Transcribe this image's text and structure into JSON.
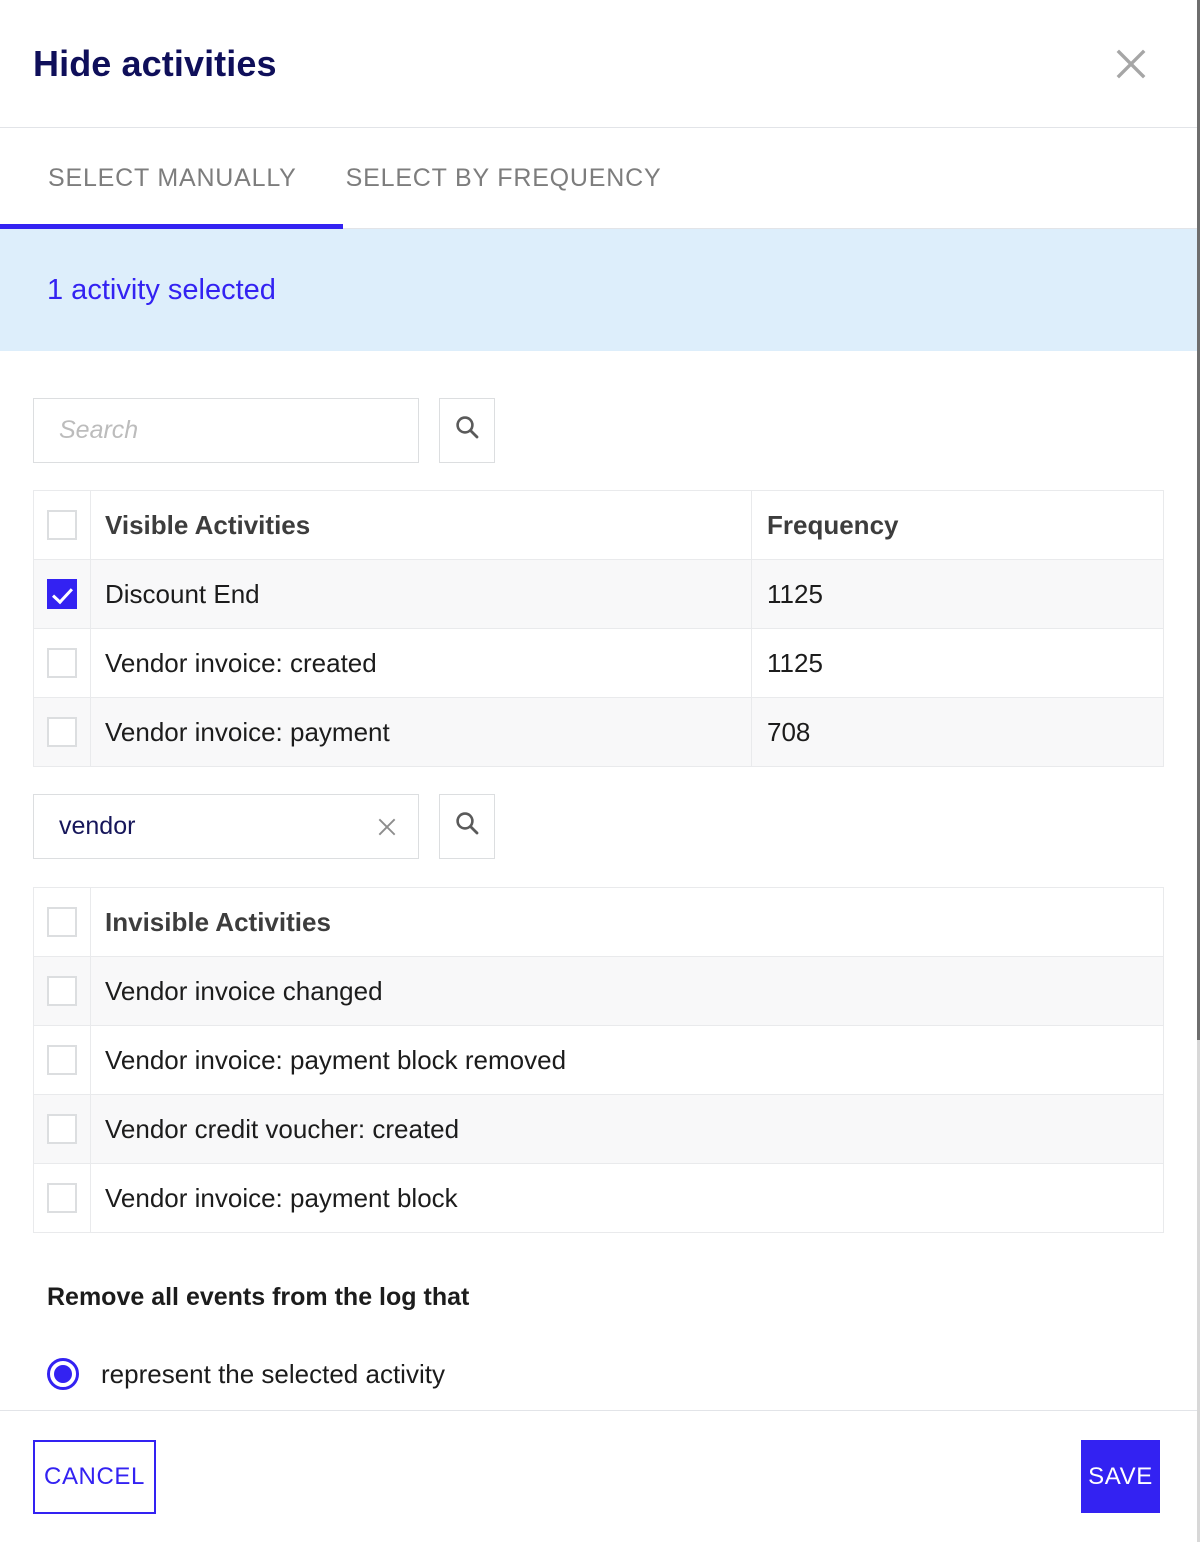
{
  "dialog": {
    "title": "Hide activities",
    "close_icon": "close-icon"
  },
  "tabs": [
    {
      "label": "SELECT MANUALLY",
      "active": true
    },
    {
      "label": "SELECT BY FREQUENCY",
      "active": false
    }
  ],
  "banner": {
    "text": "1 activity selected"
  },
  "visible_search": {
    "value": "",
    "placeholder": "Search",
    "search_icon": "search-icon"
  },
  "visible_table": {
    "columns": [
      "Visible Activities",
      "Frequency"
    ],
    "rows": [
      {
        "name": "Discount End",
        "frequency": "1125",
        "checked": true
      },
      {
        "name": "Vendor invoice: created",
        "frequency": "1125",
        "checked": false
      },
      {
        "name": "Vendor invoice: payment",
        "frequency": "708",
        "checked": false
      }
    ]
  },
  "invisible_search": {
    "value": "vendor",
    "placeholder": "Search",
    "clear_icon": "clear-icon",
    "search_icon": "search-icon"
  },
  "invisible_table": {
    "columns": [
      "Invisible Activities"
    ],
    "rows": [
      {
        "name": "Vendor invoice changed",
        "checked": false
      },
      {
        "name": "Vendor invoice: payment block removed",
        "checked": false
      },
      {
        "name": "Vendor credit voucher: created",
        "checked": false
      },
      {
        "name": "Vendor invoice: payment block",
        "checked": false
      }
    ]
  },
  "remove_section": {
    "label": "Remove all events from the log that",
    "options": [
      {
        "label": "represent the selected activity",
        "selected": true
      }
    ]
  },
  "footer": {
    "cancel_label": "CANCEL",
    "save_label": "SAVE"
  },
  "colors": {
    "accent": "#3322f2",
    "title": "#0f0f5a",
    "banner_bg": "#ddeefb",
    "row_shade": "#f8f8f9",
    "border": "#e9eaec"
  }
}
